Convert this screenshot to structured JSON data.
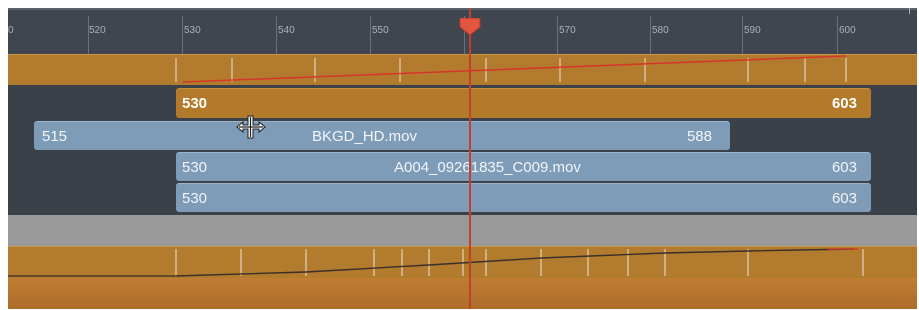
{
  "ruler": {
    "ticks": [
      "0",
      "520",
      "530",
      "540",
      "550",
      "5",
      "570",
      "580",
      "590",
      "600"
    ]
  },
  "clips": {
    "orange_top": {
      "start": "530",
      "end": "603"
    },
    "bkgd": {
      "start": "515",
      "name": "BKGD_HD.mov",
      "end": "588"
    },
    "a004": {
      "start": "530",
      "name": "A004_09261835_C009.mov",
      "end": "603"
    },
    "blue_bottom": {
      "start": "530",
      "end": "603"
    }
  },
  "colors": {
    "orange": "#b37a2b",
    "blue_clip": "#7e9bb8",
    "playhead": "#c3402a",
    "keyframe_line_top": "#d9362a",
    "keyframe_line_bottom": "#3a2f2a"
  },
  "icons": {
    "playhead": "playhead-marker-icon",
    "cursor": "move-cursor-icon"
  },
  "playhead_frame": "5"
}
